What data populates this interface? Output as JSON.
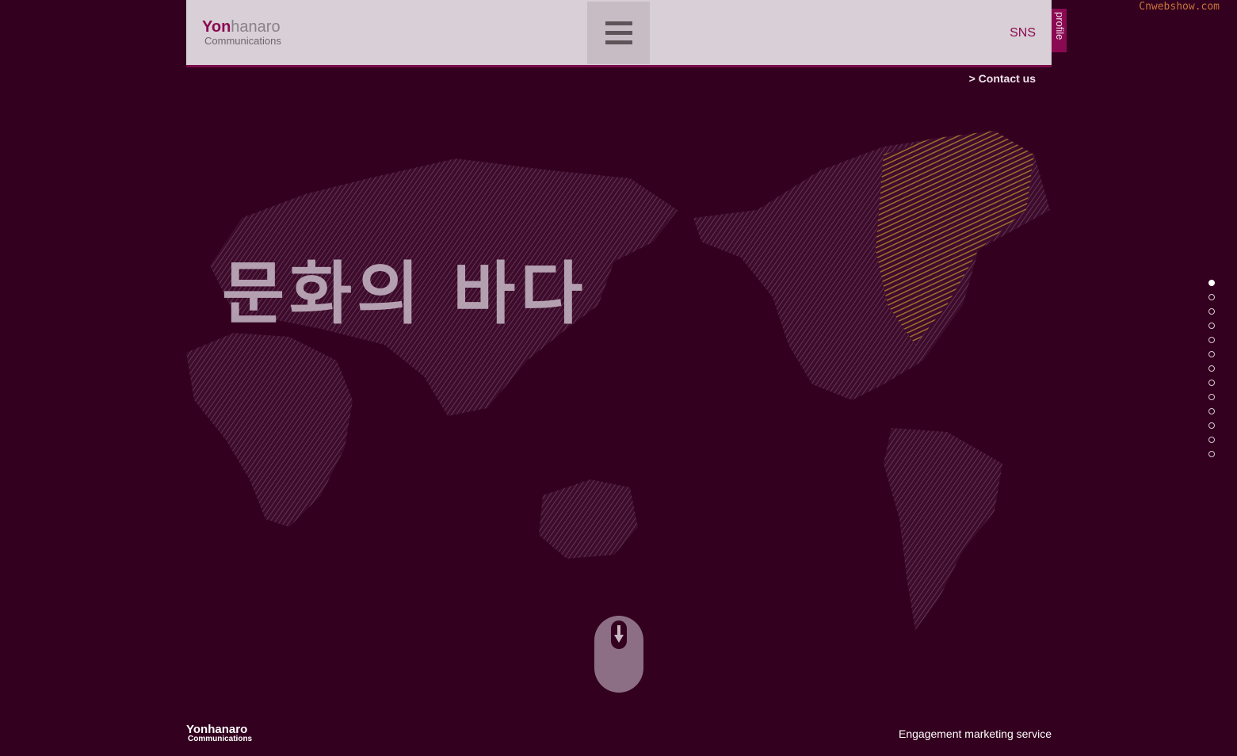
{
  "watermark": "Cnwebshow.com",
  "header": {
    "logo_yon": "Yon",
    "logo_rest": "hanaro",
    "logo_sub": "Communications",
    "sns": "SNS",
    "profile": "profile"
  },
  "contact": "> Contact us",
  "hero": {
    "text": "문화의 바다"
  },
  "pager": {
    "count": 13,
    "active_index": 0
  },
  "footer": {
    "logo_line1": "Yonhanaro",
    "logo_line2": "Communications",
    "tagline": "Engagement marketing service"
  },
  "colors": {
    "background": "#33001f",
    "brand": "#8a0a52",
    "header_bg": "#d9cfd6"
  },
  "icons": [
    "hamburger-menu-icon",
    "scroll-mouse-icon",
    "arrow-down-icon"
  ]
}
